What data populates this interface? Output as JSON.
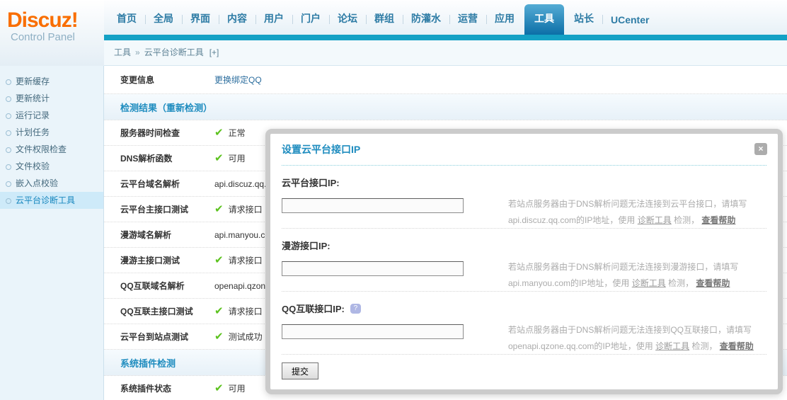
{
  "logo": {
    "title": "Discuz!",
    "subtitle": "Control Panel"
  },
  "nav": {
    "items": [
      {
        "label": "首页"
      },
      {
        "label": "全局"
      },
      {
        "label": "界面"
      },
      {
        "label": "内容"
      },
      {
        "label": "用户"
      },
      {
        "label": "门户"
      },
      {
        "label": "论坛"
      },
      {
        "label": "群组"
      },
      {
        "label": "防灌水"
      },
      {
        "label": "运营"
      },
      {
        "label": "应用"
      },
      {
        "label": "工具"
      },
      {
        "label": "站长"
      },
      {
        "label": "UCenter"
      }
    ]
  },
  "breadcrumb": {
    "section": "工具",
    "sep": "»",
    "page": "云平台诊断工具",
    "expand": "[+]"
  },
  "sidebar": {
    "items": [
      {
        "label": "更新缓存"
      },
      {
        "label": "更新统计"
      },
      {
        "label": "运行记录"
      },
      {
        "label": "计划任务"
      },
      {
        "label": "文件权限检查"
      },
      {
        "label": "文件校验"
      },
      {
        "label": "嵌入点校验"
      },
      {
        "label": "云平台诊断工具"
      }
    ]
  },
  "main": {
    "rows": [
      {
        "label": "变更信息",
        "link": "更换绑定QQ"
      },
      {
        "title": "检测结果",
        "action": "（重新检测）"
      },
      {
        "label": "服务器时间检查",
        "value": "正常"
      },
      {
        "label": "DNS解析函数",
        "value": "可用"
      },
      {
        "label": "云平台域名解析",
        "value": "api.discuz.qq.com"
      },
      {
        "label": "云平台主接口测试",
        "value": "请求接口"
      },
      {
        "label": "漫游域名解析",
        "value": "api.manyou.com"
      },
      {
        "label": "漫游主接口测试",
        "value": "请求接口"
      },
      {
        "label": "QQ互联域名解析",
        "value": "openapi.qzone.qq.com"
      },
      {
        "label": "QQ互联主接口测试",
        "value": "请求接口"
      },
      {
        "label": "云平台到站点测试",
        "value": "测试成功"
      },
      {
        "title": "系统插件检测"
      },
      {
        "label": "系统插件状态",
        "value": "可用"
      }
    ]
  },
  "modal": {
    "title": "设置云平台接口IP",
    "sections": [
      {
        "label": "云平台接口IP:",
        "help_pre": "若站点服务器由于DNS解析问题无法连接到云平台接口，请填写api.discuz.qq.com的IP地址，使用 ",
        "link1": "诊断工具",
        "mid": " 检测， ",
        "link2": "查看帮助"
      },
      {
        "label": "漫游接口IP:",
        "help_pre": "若站点服务器由于DNS解析问题无法连接到漫游接口，请填写api.manyou.com的IP地址，使用 ",
        "link1": "诊断工具",
        "mid": " 检测， ",
        "link2": "查看帮助"
      },
      {
        "label": "QQ互联接口IP:",
        "help_pre": "若站点服务器由于DNS解析问题无法连接到QQ互联接口，请填写openapi.qzone.qq.com的IP地址，使用 ",
        "link1": "诊断工具",
        "mid": " 检测， ",
        "link2": "查看帮助"
      }
    ],
    "submit": "提交"
  },
  "icons": {
    "check": "✔",
    "close": "×",
    "help": "?"
  },
  "colors": {
    "accent_blue": "#1e8cbf",
    "teal_bar": "#14a1c5",
    "logo_orange": "#f96e00",
    "check_green": "#5cc21e"
  }
}
